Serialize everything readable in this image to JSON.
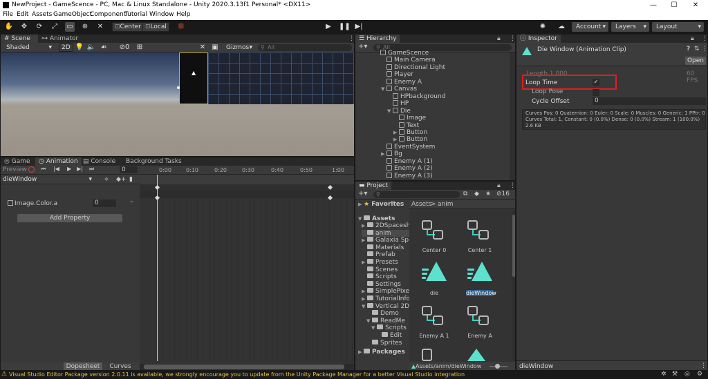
{
  "window": {
    "title": "NewProject - GameScence - PC, Mac & Linux Standalone - Unity 2020.3.13f1 Personal* <DX11>",
    "controls": [
      "—",
      "☐",
      "✕"
    ]
  },
  "menu": [
    "File",
    "Edit",
    "Assets",
    "GameObject",
    "Component",
    "Tutorial",
    "Window",
    "Help"
  ],
  "toolbar": {
    "center_label": "Center",
    "local_label": "Local",
    "account_label": "Account",
    "layers_label": "Layers",
    "layout_label": "Layout"
  },
  "scene": {
    "tab_scene": "Scene",
    "tab_animator": "Animator",
    "shading": "Shaded",
    "mode_2d": "2D",
    "fx_count": "0",
    "gizmos": "Gizmos",
    "search_placeholder": "All"
  },
  "animation": {
    "tabs": [
      "Game",
      "Animation",
      "Console",
      "Background Tasks"
    ],
    "preview_label": "Preview",
    "frame": "0",
    "clip": "dieWindow",
    "property": "Image.Color.a",
    "property_value": "0",
    "add_property": "Add Property",
    "timeline_marks": [
      "0:00",
      "0:10",
      "0:20",
      "0:30",
      "0:40",
      "0:50",
      "1:00"
    ],
    "bottom_tabs": [
      "Dopesheet",
      "Curves"
    ]
  },
  "hierarchy": {
    "title": "Hierarchy",
    "search_placeholder": "All",
    "items": [
      {
        "label": "GameScence",
        "indent": 0
      },
      {
        "label": "Main Camera",
        "indent": 1
      },
      {
        "label": "Directional Light",
        "indent": 1
      },
      {
        "label": "Player",
        "indent": 1
      },
      {
        "label": "Enemy A",
        "indent": 1
      },
      {
        "label": "Canvas",
        "indent": 1,
        "expanded": true
      },
      {
        "label": "HPbackground",
        "indent": 2
      },
      {
        "label": "HP",
        "indent": 2
      },
      {
        "label": "Die",
        "indent": 2,
        "expanded": true
      },
      {
        "label": "Image",
        "indent": 3
      },
      {
        "label": "Text",
        "indent": 3
      },
      {
        "label": "Button",
        "indent": 3,
        "collapsed": true
      },
      {
        "label": "Button",
        "indent": 3,
        "collapsed": true
      },
      {
        "label": "EventSystem",
        "indent": 1
      },
      {
        "label": "Bg",
        "indent": 1,
        "collapsed": true
      },
      {
        "label": "Enemy A (1)",
        "indent": 1
      },
      {
        "label": "Enemy A (2)",
        "indent": 1
      },
      {
        "label": "Enemy A (3)",
        "indent": 1
      }
    ]
  },
  "project": {
    "title": "Project",
    "favorites": "Favorites",
    "assets_root": "Assets",
    "hidden_count": "16",
    "breadcrumb_root": "Assets",
    "breadcrumb_leaf": "anim",
    "folders": [
      {
        "label": "2DSpacesh",
        "indent": 1,
        "collapsed": true
      },
      {
        "label": "anim",
        "indent": 1,
        "selected": true
      },
      {
        "label": "Galaxia Spr",
        "indent": 1,
        "collapsed": true
      },
      {
        "label": "Materials",
        "indent": 1
      },
      {
        "label": "Prefab",
        "indent": 1
      },
      {
        "label": "Presets",
        "indent": 1,
        "collapsed": true
      },
      {
        "label": "Scenes",
        "indent": 1
      },
      {
        "label": "Scripts",
        "indent": 1
      },
      {
        "label": "Settings",
        "indent": 1
      },
      {
        "label": "SimplePixel",
        "indent": 1,
        "collapsed": true
      },
      {
        "label": "TutorialInfo",
        "indent": 1,
        "collapsed": true
      },
      {
        "label": "Vertical 2D",
        "indent": 1,
        "expanded": true
      },
      {
        "label": "Demo",
        "indent": 2
      },
      {
        "label": "ReadMe",
        "indent": 2,
        "expanded": true
      },
      {
        "label": "Scripts",
        "indent": 3,
        "expanded": true
      },
      {
        "label": "Edit",
        "indent": 4
      },
      {
        "label": "Sprites",
        "indent": 2
      }
    ],
    "packages": "Packages",
    "assets": [
      {
        "label": "Center 0",
        "kind": "controller"
      },
      {
        "label": "Center 1",
        "kind": "controller"
      },
      {
        "label": "die",
        "kind": "clip"
      },
      {
        "label": "dieWindow",
        "kind": "clip",
        "selected": true
      },
      {
        "label": "Enemy A 1",
        "kind": "controller"
      },
      {
        "label": "Enemy A",
        "kind": "controller"
      }
    ],
    "path": "Assets/anim/dieWindow"
  },
  "inspector": {
    "title": "Inspector",
    "header": "Die Window (Animation Clip)",
    "open_button": "Open",
    "length_label": "Length",
    "length_value": "1.000",
    "fps": "60 FPS",
    "loop_time": "Loop Time",
    "loop_pose": "Loop Pose",
    "cycle_offset": "Cycle Offset",
    "cycle_offset_value": "0",
    "stats_line1": "Curves Pos: 0 Quaternion: 0 Euler: 0 Scale: 0 Muscles: 0 Generic: 1 PPtr: 0",
    "stats_line2": "Curves Total: 1, Constant: 0 (0.0%) Dense: 0 (0.0%) Stream: 1 (100.0%)",
    "stats_line3": "2.6 KB",
    "footer": "dieWindow",
    "highlight_color": "#e0201c"
  },
  "status": {
    "message": "Visual Studio Editor Package version 2.0.11 is available, we strongly encourage you to update from the Unity Package Manager for a better Visual Studio integration"
  }
}
